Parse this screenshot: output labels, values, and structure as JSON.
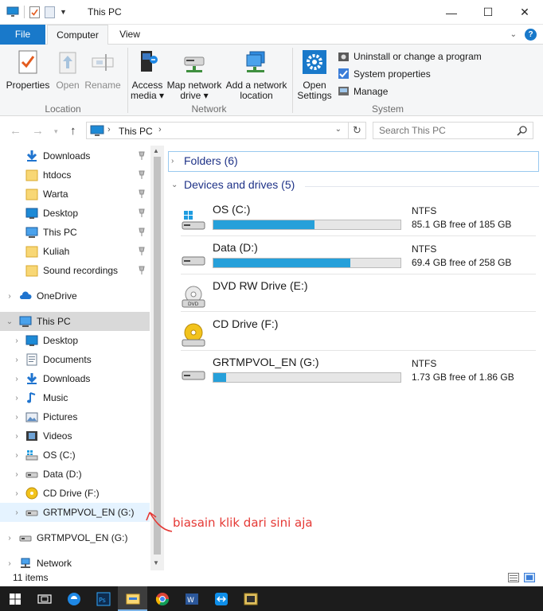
{
  "window": {
    "title": "This PC",
    "minimize_glyph": "—",
    "maximize_glyph": "☐",
    "close_glyph": "✕"
  },
  "ribbon_tabs": {
    "file": "File",
    "computer": "Computer",
    "view": "View"
  },
  "ribbon": {
    "location": {
      "label": "Location",
      "properties": "Properties",
      "open": "Open",
      "rename": "Rename"
    },
    "network": {
      "label": "Network",
      "access_media_1": "Access",
      "access_media_2": "media ▾",
      "map_drive_1": "Map network",
      "map_drive_2": "drive ▾",
      "add_location_1": "Add a network",
      "add_location_2": "location"
    },
    "system": {
      "label": "System",
      "open_settings_1": "Open",
      "open_settings_2": "Settings",
      "uninstall": "Uninstall or change a program",
      "system_properties": "System properties",
      "manage": "Manage"
    }
  },
  "address": {
    "path": "This PC",
    "search_placeholder": "Search This PC"
  },
  "nav": {
    "quick_access": [
      {
        "label": "Downloads",
        "icon": "download-icon"
      },
      {
        "label": "htdocs",
        "icon": "folder-icon"
      },
      {
        "label": "Warta",
        "icon": "folder-icon"
      },
      {
        "label": "Desktop",
        "icon": "desktop-icon"
      },
      {
        "label": "This PC",
        "icon": "computer-icon"
      },
      {
        "label": "Kuliah",
        "icon": "folder-icon"
      },
      {
        "label": "Sound recordings",
        "icon": "folder-icon"
      }
    ],
    "onedrive": "OneDrive",
    "this_pc": "This PC",
    "this_pc_children": [
      {
        "label": "Desktop",
        "icon": "desktop-icon"
      },
      {
        "label": "Documents",
        "icon": "documents-icon"
      },
      {
        "label": "Downloads",
        "icon": "download-icon"
      },
      {
        "label": "Music",
        "icon": "music-icon"
      },
      {
        "label": "Pictures",
        "icon": "pictures-icon"
      },
      {
        "label": "Videos",
        "icon": "videos-icon"
      },
      {
        "label": "OS (C:)",
        "icon": "os-drive-icon"
      },
      {
        "label": "Data (D:)",
        "icon": "drive-icon"
      },
      {
        "label": "CD Drive (F:)",
        "icon": "cd-icon"
      },
      {
        "label": "GRTMPVOL_EN (G:)",
        "icon": "drive-icon"
      }
    ],
    "removable": "GRTMPVOL_EN (G:)",
    "network": "Network"
  },
  "content": {
    "folders_header": "Folders (6)",
    "devices_header": "Devices and drives (5)",
    "drives": [
      {
        "name": "OS (C:)",
        "fs": "NTFS",
        "free": "85.1 GB free of 185 GB",
        "used_fraction": 0.54,
        "icon": "os-drive-icon"
      },
      {
        "name": "Data (D:)",
        "fs": "NTFS",
        "free": "69.4 GB free of 258 GB",
        "used_fraction": 0.73,
        "icon": "drive-icon"
      },
      {
        "name": "DVD RW Drive (E:)",
        "icon": "dvd-icon"
      },
      {
        "name": "CD Drive (F:)",
        "icon": "cd-icon"
      },
      {
        "name": "GRTMPVOL_EN (G:)",
        "fs": "NTFS",
        "free": "1.73 GB free of 1.86 GB",
        "used_fraction": 0.07,
        "icon": "drive-icon"
      }
    ]
  },
  "status": {
    "item_count": "11 items"
  },
  "annotation": {
    "text": "biasain klik dari sini aja"
  },
  "colors": {
    "accent": "#1979ca",
    "bar_fill": "#26a0da",
    "annotation": "#e53935"
  }
}
